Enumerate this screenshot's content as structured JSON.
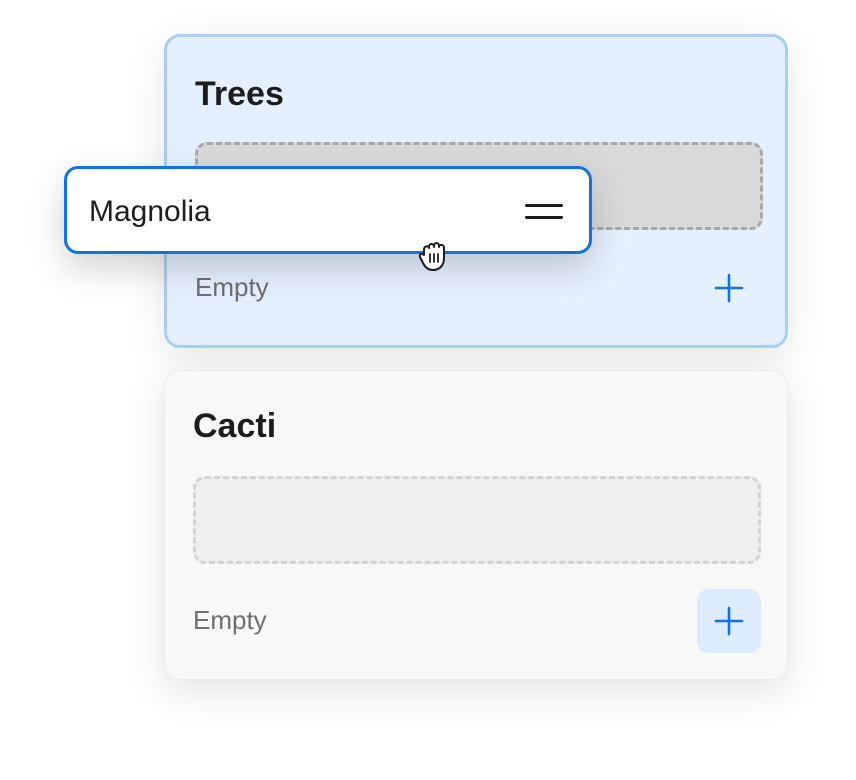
{
  "colors": {
    "accent": "#1671dc",
    "target_bg": "#e5f0fe",
    "target_border": "#a9cdf5",
    "card_bg": "#f8f8f8"
  },
  "groups": [
    {
      "title": "Trees",
      "empty_label": "Empty",
      "state": "drop-target-active",
      "add_icon": "plus-icon"
    },
    {
      "title": "Cacti",
      "empty_label": "Empty",
      "state": "idle",
      "add_icon": "plus-icon"
    }
  ],
  "dragged_item": {
    "label": "Magnolia",
    "handle_icon": "drag-handle-icon"
  },
  "cursor": {
    "icon": "grabbing-hand-cursor-icon"
  }
}
